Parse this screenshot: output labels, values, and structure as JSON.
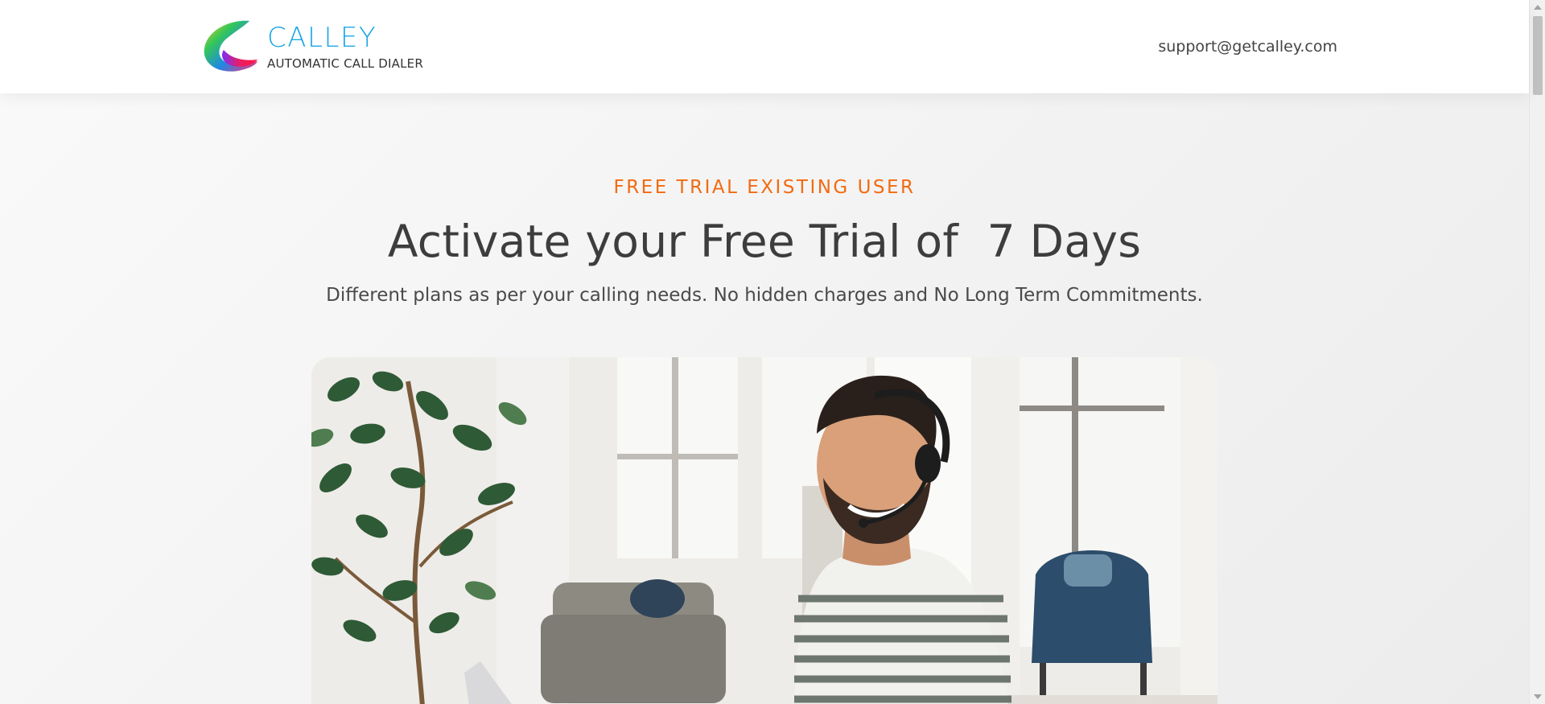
{
  "header": {
    "brand_name": "CALLEY",
    "brand_tagline": "AUTOMATIC CALL DIALER",
    "support_email": "support@getcalley.com"
  },
  "hero": {
    "eyebrow": "FREE TRIAL EXISTING USER",
    "headline": "Activate your Free Trial of  7 Days",
    "subline": "Different plans as per your calling needs. No hidden charges and No Long Term Commitments."
  },
  "icons": {
    "logo": "calley-swirl-logo",
    "scroll_up": "triangle-up-icon",
    "scroll_down": "triangle-down-icon"
  },
  "colors": {
    "accent_orange": "#f26b10",
    "brand_blue": "#1ea7e4",
    "text_dark": "#3d3d3d"
  }
}
